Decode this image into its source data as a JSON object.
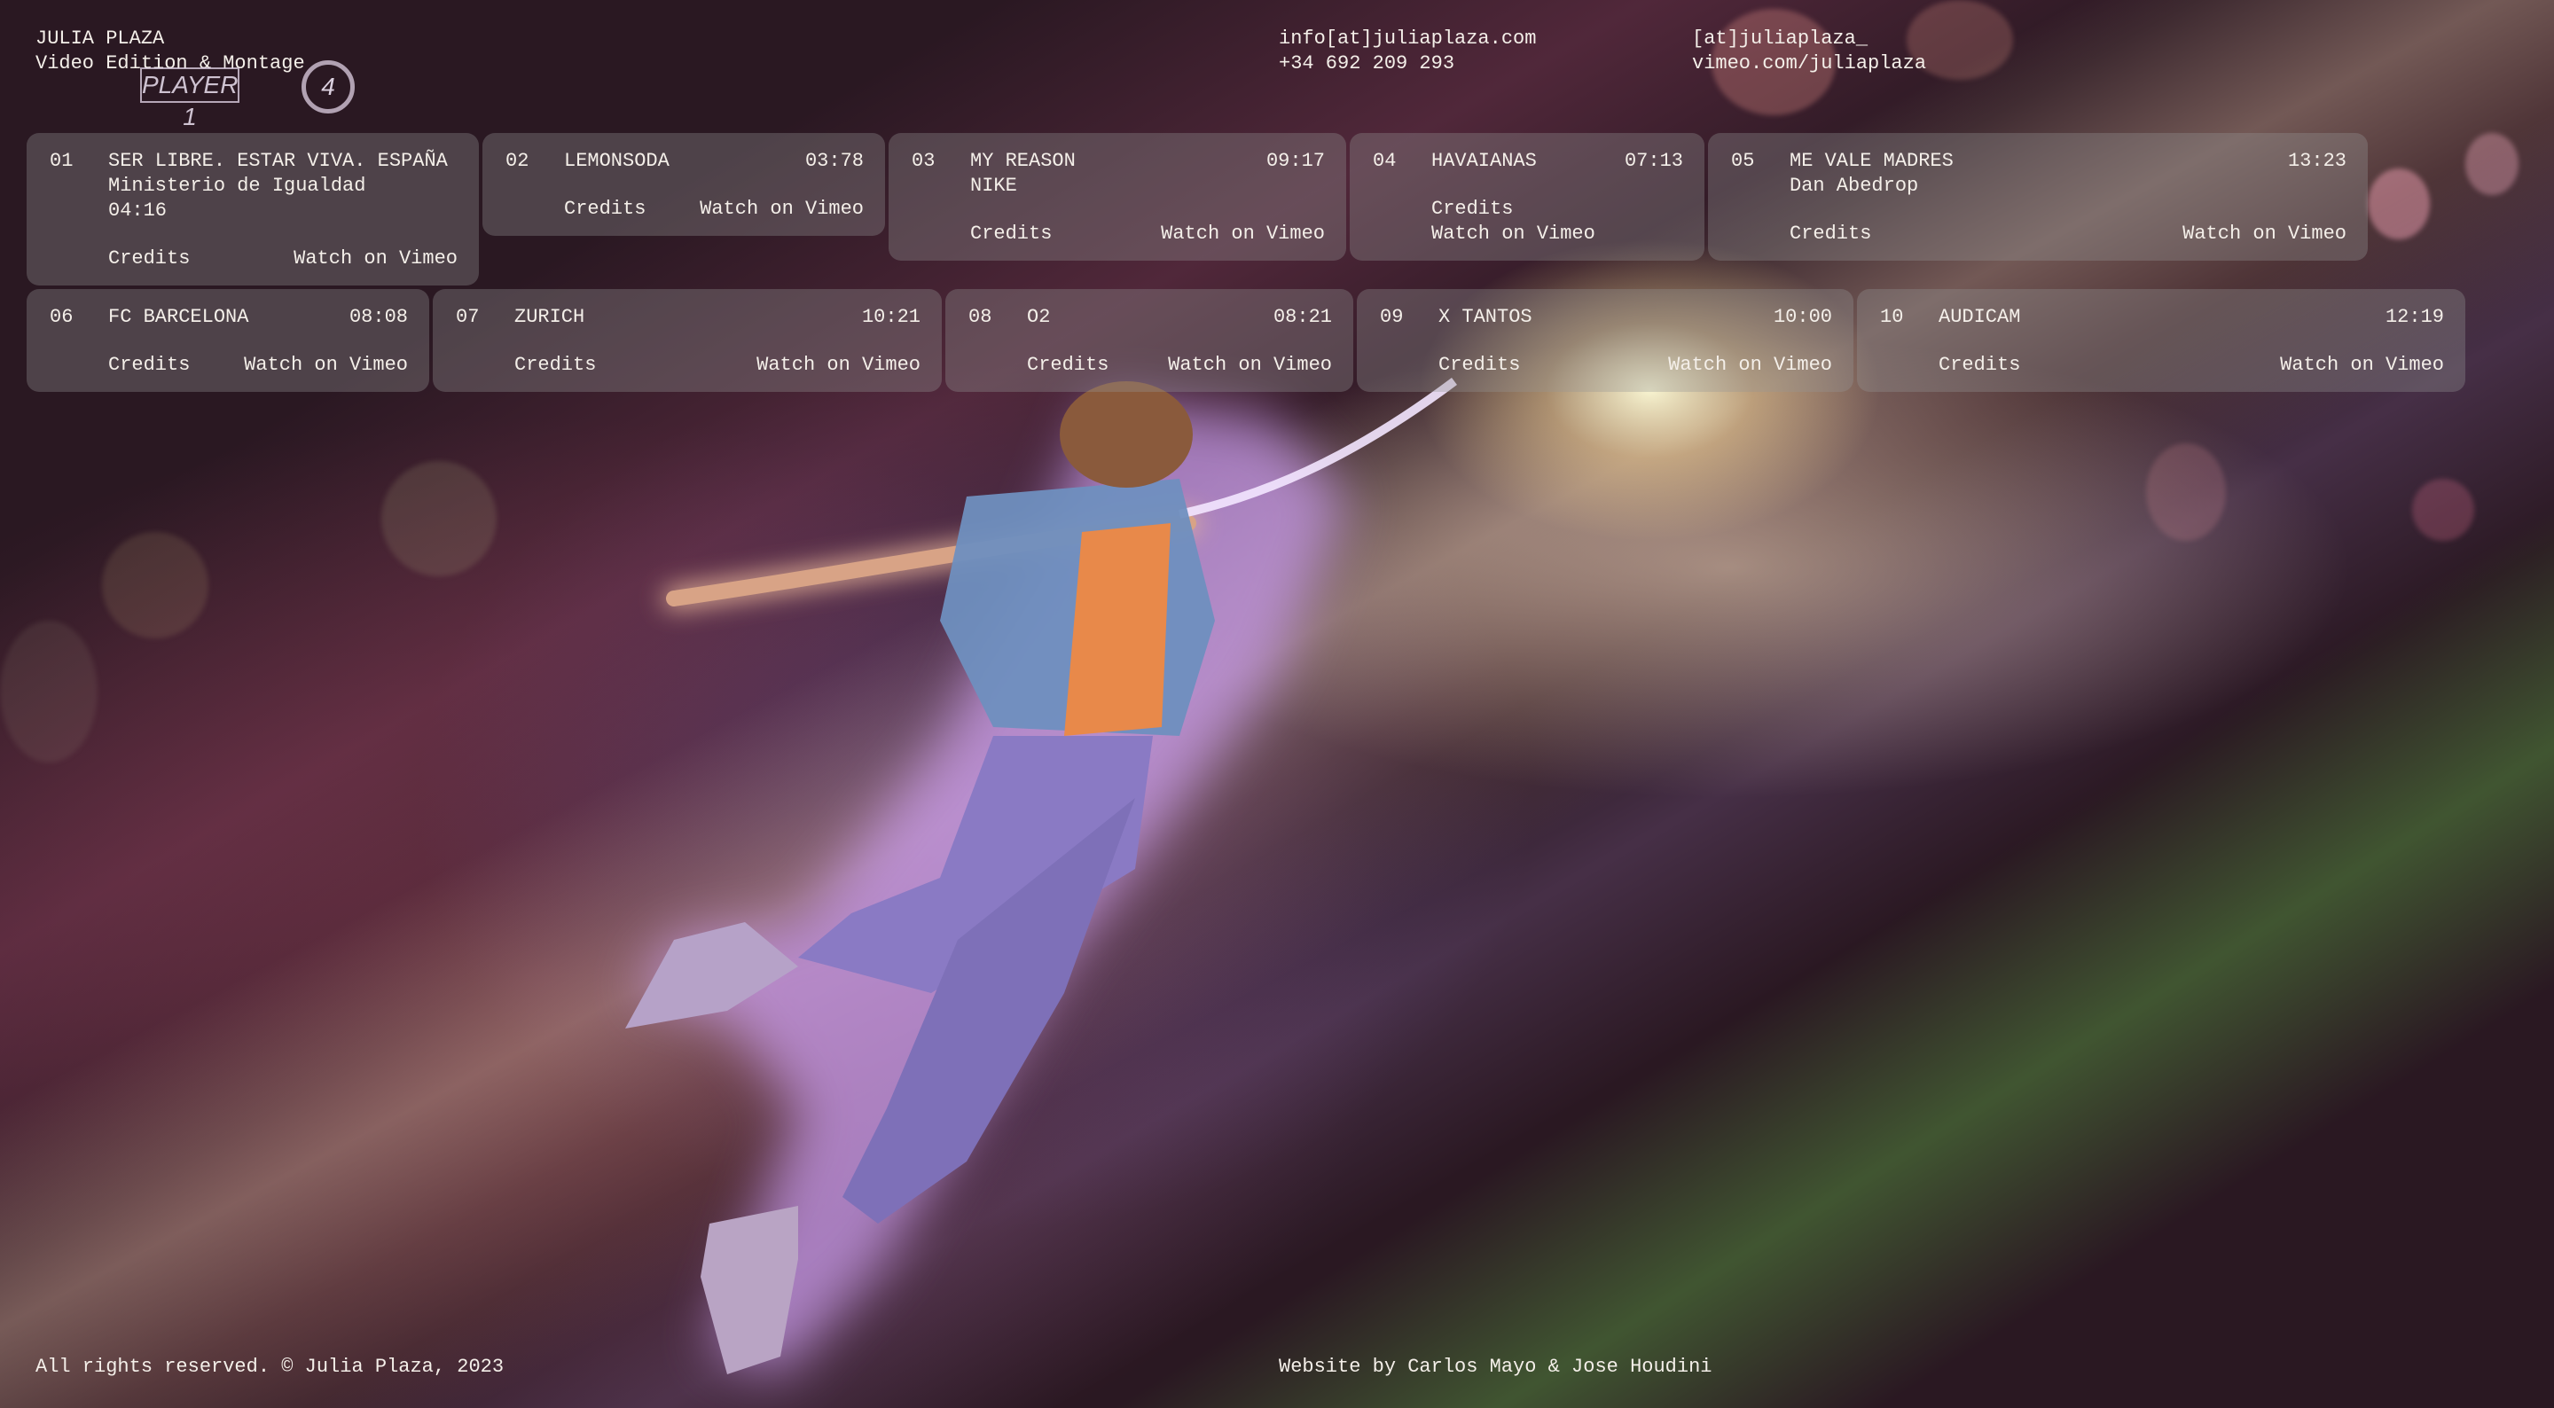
{
  "header": {
    "name": "JULIA PLAZA",
    "role": "Video Edition & Montage",
    "email": "info[at]juliaplaza.com",
    "phone": "+34 692 209 293",
    "social": "[at]juliaplaza_",
    "vimeo": "vimeo.com/juliaplaza"
  },
  "overlay": {
    "player_label": "PLAYER 1",
    "player_number": "4"
  },
  "projects": [
    {
      "num": "01",
      "title": "SER LIBRE. ESTAR VIVA. ESPAÑA",
      "client": "Ministerio de Igualdad",
      "time": "04:16",
      "credits": "Credits",
      "watch": "Watch on Vimeo"
    },
    {
      "num": "02",
      "title": "LEMONSODA",
      "client": "",
      "time": "03:78",
      "credits": "Credits",
      "watch": "Watch on Vimeo"
    },
    {
      "num": "03",
      "title": "MY REASON",
      "client": "NIKE",
      "time": "09:17",
      "credits": "Credits",
      "watch": "Watch on Vimeo"
    },
    {
      "num": "04",
      "title": "HAVAIANAS",
      "client": "",
      "time": "07:13",
      "credits": "Credits",
      "watch": "Watch on Vimeo"
    },
    {
      "num": "05",
      "title": "ME VALE MADRES",
      "client": "Dan Abedrop",
      "time": "13:23",
      "credits": "Credits",
      "watch": "Watch on Vimeo"
    },
    {
      "num": "06",
      "title": "FC BARCELONA",
      "client": "",
      "time": "08:08",
      "credits": "Credits",
      "watch": "Watch on Vimeo"
    },
    {
      "num": "07",
      "title": "ZURICH",
      "client": "",
      "time": "10:21",
      "credits": "Credits",
      "watch": "Watch on Vimeo"
    },
    {
      "num": "08",
      "title": "O2",
      "client": "",
      "time": "08:21",
      "credits": "Credits",
      "watch": "Watch on Vimeo"
    },
    {
      "num": "09",
      "title": "X TANTOS",
      "client": "",
      "time": "10:00",
      "credits": "Credits",
      "watch": "Watch on Vimeo"
    },
    {
      "num": "10",
      "title": "AUDICAM",
      "client": "",
      "time": "12:19",
      "credits": "Credits",
      "watch": "Watch on Vimeo"
    }
  ],
  "footer": {
    "rights": "All rights reserved. © Julia Plaza, 2023",
    "credit": "Website by Carlos Mayo & Jose Houdini"
  }
}
